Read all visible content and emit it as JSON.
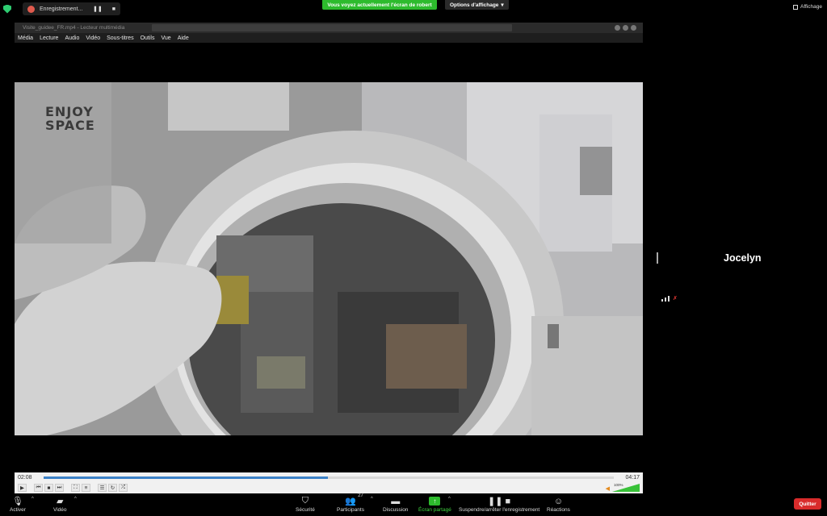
{
  "top_bar": {
    "recording_label": "Enregistrement...",
    "recording_pause": "❚❚",
    "recording_stop": "■",
    "sharing_banner": "Vous voyez actuellement l'écran de robert",
    "view_options": "Options d'affichage",
    "view_options_caret": "▾",
    "affichage": "Affichage"
  },
  "player": {
    "title": "Visite_guidee_FR.mp4 - Lecteur multimédia",
    "menu": [
      "Média",
      "Lecture",
      "Audio",
      "Vidéo",
      "Sous-titres",
      "Outils",
      "Vue",
      "Aide"
    ],
    "video_logo_line1": "ENJOY",
    "video_logo_line2": "SPACE",
    "time_current": "02:08",
    "time_total": "04:17",
    "progress": 0.498,
    "volume_percent": "100%",
    "volume_level": 1.0
  },
  "participant": {
    "name": "Jocelyn",
    "mic_muted_icon": "✗"
  },
  "toolbar": {
    "activer": "Activer",
    "video": "Vidéo",
    "securite": "Sécurité",
    "participants": "Participants",
    "participants_count": "27",
    "discussion": "Discussion",
    "ecran_partage": "Écran partagé",
    "suspendre": "Suspendre/arrêter l'enregistrement",
    "reactions": "Réactions",
    "quitter": "Quitter",
    "caret": "^"
  },
  "colors": {
    "share_green": "#2dbb2d",
    "quit_red": "#d92b2b",
    "seek_blue": "#3c82c8"
  }
}
